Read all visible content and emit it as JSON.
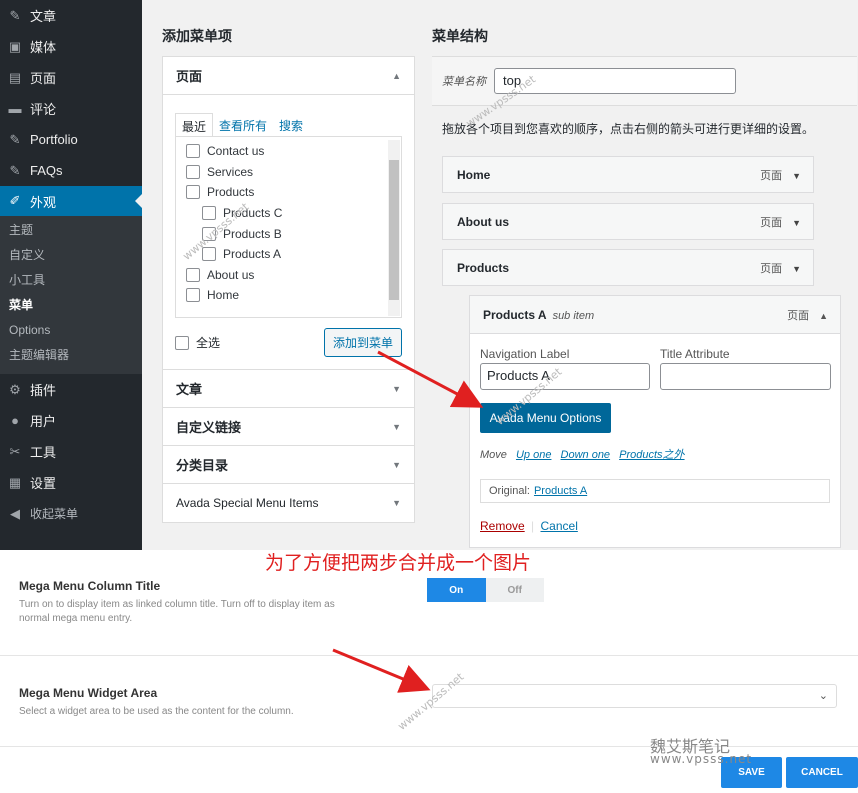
{
  "sidebar": {
    "items_top": [
      {
        "label": "文章",
        "icon": "pin-icon"
      },
      {
        "label": "媒体",
        "icon": "media-icon"
      },
      {
        "label": "页面",
        "icon": "page-icon"
      },
      {
        "label": "评论",
        "icon": "comment-icon"
      },
      {
        "label": "Portfolio",
        "icon": "pin-icon"
      },
      {
        "label": "FAQs",
        "icon": "pin-icon"
      }
    ],
    "active": {
      "label": "外观",
      "icon": "brush-icon"
    },
    "sub_items": [
      "主题",
      "自定义",
      "小工具",
      "菜单",
      "Options",
      "主题编辑器"
    ],
    "items_bottom": [
      {
        "label": "插件",
        "icon": "plugin-icon"
      },
      {
        "label": "用户",
        "icon": "user-icon"
      },
      {
        "label": "工具",
        "icon": "wrench-icon"
      },
      {
        "label": "设置",
        "icon": "settings-icon"
      },
      {
        "label": "收起菜单",
        "icon": "collapse-icon"
      }
    ]
  },
  "add_items": {
    "title": "添加菜单项",
    "pages_header": "页面",
    "tabs": [
      "最近",
      "查看所有",
      "搜索"
    ],
    "checklist": [
      {
        "label": "Contact us",
        "indent": 0
      },
      {
        "label": "Services",
        "indent": 0
      },
      {
        "label": "Products",
        "indent": 0
      },
      {
        "label": "Products C",
        "indent": 1
      },
      {
        "label": "Products B",
        "indent": 1
      },
      {
        "label": "Products A",
        "indent": 1
      },
      {
        "label": "About us",
        "indent": 0
      },
      {
        "label": "Home",
        "indent": 0
      }
    ],
    "select_all": "全选",
    "add_button": "添加到菜单",
    "sections": [
      "文章",
      "自定义链接",
      "分类目录",
      "Avada Special Menu Items"
    ]
  },
  "structure": {
    "title": "菜单结构",
    "name_label": "菜单名称",
    "name_value": "top",
    "hint": "拖放各个项目到您喜欢的顺序，点击右侧的箭头可进行更详细的设置。",
    "items": [
      {
        "label": "Home",
        "type": "页面"
      },
      {
        "label": "About us",
        "type": "页面"
      },
      {
        "label": "Products",
        "type": "页面"
      }
    ],
    "expanded": {
      "label": "Products A",
      "sub": "sub item",
      "type": "页面",
      "nav_label_title": "Navigation Label",
      "nav_label_value": "Products A",
      "title_attr_title": "Title Attribute",
      "title_attr_value": "",
      "avada_button": "Avada Menu Options",
      "move_label": "Move",
      "move_links": [
        "Up one",
        "Down one",
        "Products之外"
      ],
      "original_label": "Original:",
      "original_link": "Products A",
      "remove": "Remove",
      "separator": "|",
      "cancel": "Cancel"
    }
  },
  "caption": "为了方便把两步合并成一个图片",
  "mega": {
    "column_title": "Mega Menu Column Title",
    "column_desc": "Turn on to display item as linked column title. Turn off to display item as normal mega menu entry.",
    "toggle_on": "On",
    "toggle_off": "Off",
    "widget_title": "Mega Menu Widget Area",
    "widget_desc": "Select a widget area to be used as the content for the column.",
    "save": "SAVE",
    "cancel": "CANCEL"
  },
  "watermark": {
    "brand": "魏艾斯笔记",
    "url": "www.vpsss.net"
  },
  "colors": {
    "sidebar_bg": "#23282d",
    "wp_blue": "#0073aa",
    "avada_blue": "#1e88e5",
    "annotation_red": "#e02020"
  }
}
